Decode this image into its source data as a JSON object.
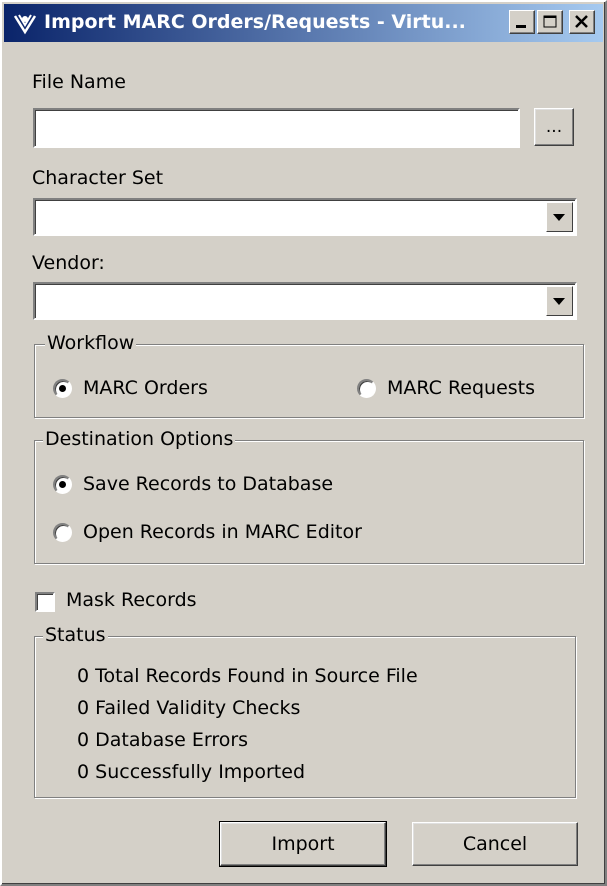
{
  "window": {
    "title": "Import MARC Orders/Requests - Virtu..."
  },
  "file": {
    "label": "File Name",
    "value": "",
    "browse_label": "..."
  },
  "charset": {
    "label": "Character Set",
    "value": ""
  },
  "vendor": {
    "label": "Vendor:",
    "value": ""
  },
  "workflow": {
    "legend": "Workflow",
    "options": [
      {
        "label": "MARC Orders",
        "checked": true
      },
      {
        "label": "MARC Requests",
        "checked": false
      }
    ]
  },
  "destination": {
    "legend": "Destination Options",
    "options": [
      {
        "label": "Save Records to Database",
        "checked": true
      },
      {
        "label": "Open Records in MARC Editor",
        "checked": false
      }
    ]
  },
  "mask": {
    "label": "Mask Records",
    "checked": false
  },
  "status": {
    "legend": "Status",
    "rows": [
      {
        "count": "0",
        "label": "Total Records Found in Source File"
      },
      {
        "count": "0",
        "label": "Failed Validity Checks"
      },
      {
        "count": "0",
        "label": "Database Errors"
      },
      {
        "count": "0",
        "label": "Successfully Imported"
      }
    ]
  },
  "buttons": {
    "import_label": "Import",
    "cancel_label": "Cancel"
  }
}
